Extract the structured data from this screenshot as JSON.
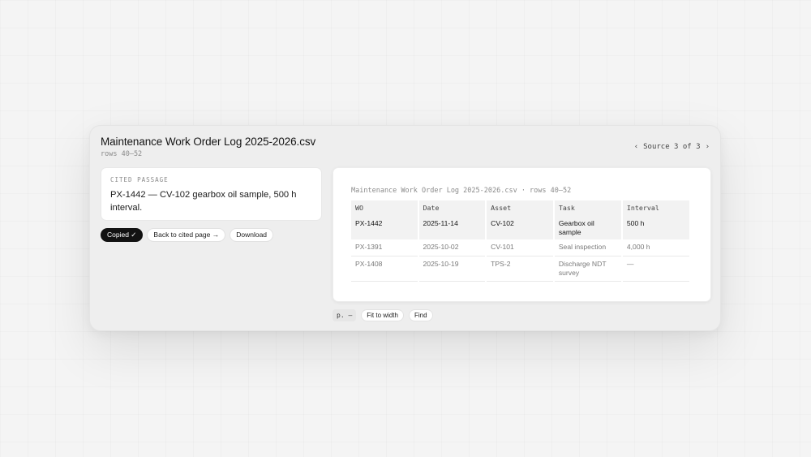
{
  "document": {
    "title": "Maintenance Work Order Log 2025-2026.csv",
    "subtitle": "rows 40–52"
  },
  "source_nav": {
    "prev": "‹",
    "label": "Source 3 of 3",
    "next": "›"
  },
  "cited": {
    "label": "CITED PASSAGE",
    "text": "PX-1442 — CV-102 gearbox oil sample, 500 h interval."
  },
  "actions": {
    "copied": "Copied ✓",
    "back": "Back to cited page →",
    "download": "Download"
  },
  "preview": {
    "header": "Maintenance Work Order Log 2025-2026.csv · rows 40–52",
    "columns": [
      "WO",
      "Date",
      "Asset",
      "Task",
      "Interval"
    ],
    "rows": [
      [
        "PX-1442",
        "2025-11-14",
        "CV-102",
        "Gearbox oil sample",
        "500 h"
      ],
      [
        "PX-1391",
        "2025-10-02",
        "CV-101",
        "Seal inspection",
        "4,000 h"
      ],
      [
        "PX-1408",
        "2025-10-19",
        "TPS-2",
        "Discharge NDT survey",
        "—"
      ]
    ]
  },
  "toolbar": {
    "page": "p. —",
    "fit": "Fit to width",
    "find": "Find"
  }
}
